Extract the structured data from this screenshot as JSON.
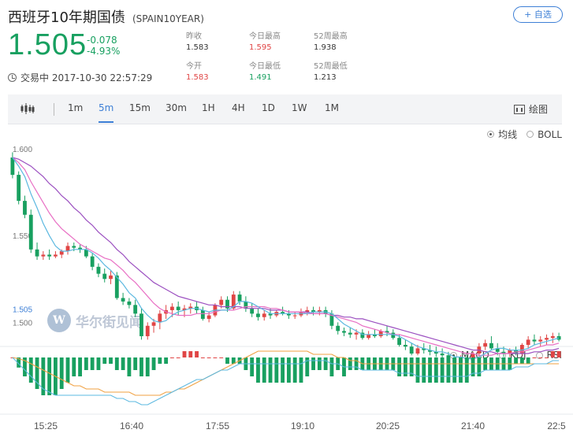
{
  "header": {
    "title": "西班牙10年期国债",
    "code": "(SPAIN10YEAR)",
    "add_button": "+ 自选"
  },
  "quote": {
    "price": "1.505",
    "change": "-0.078",
    "change_pct": "-4.93%",
    "status": "交易中 2017-10-30 22:57:29"
  },
  "stats": {
    "prev_close_label": "昨收",
    "prev_close": "1.583",
    "open_label": "今开",
    "open": "1.583",
    "high_label": "今日最高",
    "high": "1.595",
    "low_label": "今日最低",
    "low": "1.491",
    "w52_high_label": "52周最高",
    "w52_high": "1.938",
    "w52_low_label": "52周最低",
    "w52_low": "1.213"
  },
  "toolbar": {
    "periods": [
      "1m",
      "5m",
      "15m",
      "30m",
      "1H",
      "4H",
      "1D",
      "1W",
      "1M"
    ],
    "active_period": "5m",
    "draw_label": "绘图"
  },
  "main_options": {
    "ma": "均线",
    "boll": "BOLL",
    "selected": "均线"
  },
  "sub_options": {
    "macd": "MACD",
    "kdj": "KDJ",
    "rsi": "RSI",
    "selected": "MACD"
  },
  "watermark": {
    "logo": "W",
    "text": "华尔街见闻"
  },
  "colors": {
    "up": "#e04545",
    "down": "#18a060",
    "ma_short": "#5bb8e0",
    "ma_mid": "#e86fc4",
    "ma_long": "#9b4fc0",
    "macd_dea": "#f0a040",
    "accent": "#3d7fd6"
  },
  "chart_data": {
    "type": "candlestick",
    "title": "",
    "interval": "5m",
    "x_ticks": [
      "15:25",
      "16:40",
      "17:55",
      "19:10",
      "20:25",
      "21:40",
      "22:5"
    ],
    "y_ticks": [
      "1.600",
      "1.550",
      "1.500"
    ],
    "last_price_label": "1.505",
    "ylim": [
      1.487,
      1.605
    ],
    "ohlc": [
      [
        1.595,
        1.598,
        1.583,
        1.585
      ],
      [
        1.585,
        1.587,
        1.568,
        1.57
      ],
      [
        1.57,
        1.573,
        1.56,
        1.562
      ],
      [
        1.562,
        1.565,
        1.54,
        1.542
      ],
      [
        1.542,
        1.546,
        1.536,
        1.538
      ],
      [
        1.538,
        1.541,
        1.536,
        1.539
      ],
      [
        1.539,
        1.542,
        1.536,
        1.538
      ],
      [
        1.538,
        1.541,
        1.537,
        1.539
      ],
      [
        1.539,
        1.542,
        1.537,
        1.541
      ],
      [
        1.541,
        1.546,
        1.539,
        1.544
      ],
      [
        1.544,
        1.546,
        1.541,
        1.543
      ],
      [
        1.543,
        1.545,
        1.54,
        1.542
      ],
      [
        1.542,
        1.544,
        1.537,
        1.538
      ],
      [
        1.538,
        1.54,
        1.53,
        1.532
      ],
      [
        1.532,
        1.534,
        1.526,
        1.528
      ],
      [
        1.528,
        1.531,
        1.523,
        1.525
      ],
      [
        1.525,
        1.53,
        1.522,
        1.527
      ],
      [
        1.527,
        1.529,
        1.513,
        1.514
      ],
      [
        1.514,
        1.517,
        1.51,
        1.512
      ],
      [
        1.512,
        1.514,
        1.508,
        1.51
      ],
      [
        1.51,
        1.513,
        1.503,
        1.505
      ],
      [
        1.505,
        1.508,
        1.49,
        1.492
      ],
      [
        1.492,
        1.5,
        1.49,
        1.498
      ],
      [
        1.498,
        1.502,
        1.494,
        1.5
      ],
      [
        1.5,
        1.507,
        1.496,
        1.505
      ],
      [
        1.505,
        1.51,
        1.502,
        1.507
      ],
      [
        1.507,
        1.511,
        1.503,
        1.509
      ],
      [
        1.509,
        1.512,
        1.504,
        1.507
      ],
      [
        1.507,
        1.51,
        1.503,
        1.508
      ],
      [
        1.508,
        1.511,
        1.505,
        1.509
      ],
      [
        1.509,
        1.512,
        1.505,
        1.507
      ],
      [
        1.507,
        1.509,
        1.501,
        1.502
      ],
      [
        1.502,
        1.506,
        1.5,
        1.504
      ],
      [
        1.504,
        1.511,
        1.503,
        1.51
      ],
      [
        1.51,
        1.515,
        1.508,
        1.513
      ],
      [
        1.513,
        1.515,
        1.506,
        1.508
      ],
      [
        1.508,
        1.518,
        1.507,
        1.516
      ],
      [
        1.516,
        1.518,
        1.51,
        1.512
      ],
      [
        1.512,
        1.515,
        1.506,
        1.508
      ],
      [
        1.508,
        1.511,
        1.503,
        1.505
      ],
      [
        1.505,
        1.508,
        1.501,
        1.503
      ],
      [
        1.503,
        1.507,
        1.501,
        1.505
      ],
      [
        1.505,
        1.508,
        1.502,
        1.504
      ],
      [
        1.504,
        1.507,
        1.503,
        1.506
      ],
      [
        1.506,
        1.509,
        1.504,
        1.505
      ],
      [
        1.505,
        1.507,
        1.502,
        1.504
      ],
      [
        1.504,
        1.506,
        1.502,
        1.504
      ],
      [
        1.504,
        1.508,
        1.503,
        1.506
      ],
      [
        1.506,
        1.509,
        1.504,
        1.507
      ],
      [
        1.507,
        1.509,
        1.504,
        1.506
      ],
      [
        1.506,
        1.509,
        1.504,
        1.507
      ],
      [
        1.507,
        1.509,
        1.503,
        1.505
      ],
      [
        1.505,
        1.507,
        1.496,
        1.498
      ],
      [
        1.498,
        1.5,
        1.493,
        1.495
      ],
      [
        1.495,
        1.497,
        1.492,
        1.494
      ],
      [
        1.494,
        1.497,
        1.491,
        1.493
      ],
      [
        1.493,
        1.496,
        1.49,
        1.494
      ],
      [
        1.494,
        1.496,
        1.49,
        1.491
      ],
      [
        1.491,
        1.495,
        1.49,
        1.493
      ],
      [
        1.493,
        1.496,
        1.491,
        1.492
      ],
      [
        1.492,
        1.496,
        1.491,
        1.495
      ],
      [
        1.495,
        1.498,
        1.492,
        1.494
      ],
      [
        1.494,
        1.496,
        1.49,
        1.491
      ],
      [
        1.491,
        1.493,
        1.486,
        1.487
      ],
      [
        1.487,
        1.49,
        1.484,
        1.486
      ],
      [
        1.486,
        1.488,
        1.481,
        1.482
      ],
      [
        1.482,
        1.487,
        1.481,
        1.485
      ],
      [
        1.485,
        1.488,
        1.482,
        1.484
      ],
      [
        1.484,
        1.487,
        1.481,
        1.483
      ],
      [
        1.483,
        1.486,
        1.48,
        1.482
      ],
      [
        1.482,
        1.485,
        1.479,
        1.481
      ],
      [
        1.481,
        1.483,
        1.478,
        1.479
      ],
      [
        1.479,
        1.481,
        1.476,
        1.477
      ],
      [
        1.477,
        1.481,
        1.476,
        1.479
      ],
      [
        1.479,
        1.481,
        1.477,
        1.478
      ],
      [
        1.478,
        1.483,
        1.477,
        1.482
      ],
      [
        1.482,
        1.488,
        1.48,
        1.486
      ],
      [
        1.486,
        1.49,
        1.484,
        1.488
      ],
      [
        1.488,
        1.492,
        1.484,
        1.485
      ],
      [
        1.485,
        1.488,
        1.481,
        1.483
      ],
      [
        1.483,
        1.486,
        1.48,
        1.482
      ],
      [
        1.482,
        1.485,
        1.48,
        1.484
      ],
      [
        1.484,
        1.486,
        1.481,
        1.482
      ],
      [
        1.482,
        1.488,
        1.481,
        1.487
      ],
      [
        1.487,
        1.492,
        1.485,
        1.49
      ],
      [
        1.49,
        1.493,
        1.487,
        1.489
      ],
      [
        1.489,
        1.492,
        1.486,
        1.49
      ],
      [
        1.49,
        1.493,
        1.487,
        1.491
      ],
      [
        1.491,
        1.494,
        1.488,
        1.492
      ],
      [
        1.492,
        1.494,
        1.489,
        1.49
      ]
    ],
    "ma5": [
      1.595,
      1.59,
      1.584,
      1.574,
      1.566,
      1.557,
      1.55,
      1.544,
      1.541,
      1.541,
      1.542,
      1.542,
      1.542,
      1.54,
      1.537,
      1.533,
      1.53,
      1.526,
      1.522,
      1.517,
      1.514,
      1.508,
      1.504,
      1.501,
      1.5,
      1.501,
      1.504,
      1.506,
      1.507,
      1.508,
      1.508,
      1.507,
      1.506,
      1.507,
      1.507,
      1.507,
      1.509,
      1.512,
      1.512,
      1.511,
      1.509,
      1.507,
      1.505,
      1.505,
      1.505,
      1.505,
      1.505,
      1.505,
      1.505,
      1.506,
      1.506,
      1.506,
      1.505,
      1.502,
      1.499,
      1.497,
      1.495,
      1.493,
      1.493,
      1.493,
      1.493,
      1.493,
      1.493,
      1.492,
      1.49,
      1.488,
      1.486,
      1.485,
      1.484,
      1.483,
      1.483,
      1.482,
      1.48,
      1.48,
      1.479,
      1.479,
      1.48,
      1.482,
      1.484,
      1.485,
      1.485,
      1.484,
      1.484,
      1.484,
      1.485,
      1.487,
      1.488,
      1.489,
      1.49,
      1.491
    ],
    "ma10": [
      1.595,
      1.592,
      1.588,
      1.581,
      1.575,
      1.569,
      1.563,
      1.558,
      1.554,
      1.551,
      1.548,
      1.545,
      1.543,
      1.541,
      1.539,
      1.537,
      1.536,
      1.533,
      1.53,
      1.526,
      1.523,
      1.519,
      1.515,
      1.511,
      1.508,
      1.506,
      1.505,
      1.504,
      1.504,
      1.504,
      1.505,
      1.505,
      1.505,
      1.506,
      1.507,
      1.507,
      1.507,
      1.508,
      1.509,
      1.509,
      1.509,
      1.509,
      1.508,
      1.508,
      1.507,
      1.506,
      1.506,
      1.506,
      1.505,
      1.505,
      1.505,
      1.505,
      1.504,
      1.503,
      1.502,
      1.501,
      1.5,
      1.498,
      1.497,
      1.496,
      1.495,
      1.494,
      1.493,
      1.493,
      1.492,
      1.491,
      1.49,
      1.489,
      1.488,
      1.487,
      1.486,
      1.485,
      1.484,
      1.483,
      1.482,
      1.482,
      1.481,
      1.481,
      1.481,
      1.482,
      1.482,
      1.482,
      1.483,
      1.483,
      1.484,
      1.485,
      1.486,
      1.487,
      1.487,
      1.488
    ],
    "ma20": [
      1.595,
      1.594,
      1.592,
      1.59,
      1.587,
      1.584,
      1.58,
      1.577,
      1.573,
      1.57,
      1.566,
      1.563,
      1.559,
      1.556,
      1.552,
      1.549,
      1.546,
      1.542,
      1.539,
      1.535,
      1.532,
      1.529,
      1.526,
      1.523,
      1.521,
      1.519,
      1.517,
      1.515,
      1.514,
      1.513,
      1.512,
      1.511,
      1.51,
      1.51,
      1.509,
      1.509,
      1.509,
      1.509,
      1.508,
      1.508,
      1.508,
      1.508,
      1.507,
      1.507,
      1.507,
      1.506,
      1.506,
      1.506,
      1.506,
      1.505,
      1.505,
      1.505,
      1.504,
      1.504,
      1.503,
      1.503,
      1.502,
      1.502,
      1.501,
      1.5,
      1.499,
      1.498,
      1.497,
      1.496,
      1.495,
      1.494,
      1.493,
      1.492,
      1.491,
      1.49,
      1.489,
      1.488,
      1.487,
      1.486,
      1.485,
      1.484,
      1.484,
      1.483,
      1.483,
      1.482,
      1.482,
      1.482,
      1.482,
      1.482,
      1.482,
      1.483,
      1.483,
      1.484,
      1.484,
      1.485
    ],
    "macd": {
      "dif": [
        0,
        -0.002,
        -0.004,
        -0.006,
        -0.008,
        -0.01,
        -0.011,
        -0.012,
        -0.012,
        -0.012,
        -0.012,
        -0.012,
        -0.012,
        -0.012,
        -0.012,
        -0.012,
        -0.012,
        -0.013,
        -0.013,
        -0.014,
        -0.014,
        -0.015,
        -0.015,
        -0.014,
        -0.013,
        -0.012,
        -0.011,
        -0.01,
        -0.009,
        -0.008,
        -0.007,
        -0.007,
        -0.006,
        -0.005,
        -0.004,
        -0.004,
        -0.003,
        -0.002,
        -0.002,
        -0.002,
        -0.002,
        -0.002,
        -0.002,
        -0.002,
        -0.002,
        -0.002,
        -0.002,
        -0.002,
        -0.001,
        -0.001,
        -0.001,
        -0.001,
        -0.002,
        -0.002,
        -0.003,
        -0.003,
        -0.003,
        -0.004,
        -0.004,
        -0.004,
        -0.004,
        -0.004,
        -0.004,
        -0.005,
        -0.005,
        -0.005,
        -0.006,
        -0.006,
        -0.006,
        -0.006,
        -0.006,
        -0.006,
        -0.006,
        -0.006,
        -0.006,
        -0.005,
        -0.005,
        -0.004,
        -0.004,
        -0.004,
        -0.004,
        -0.004,
        -0.003,
        -0.003,
        -0.003,
        -0.002,
        -0.002,
        -0.002,
        -0.001,
        -0.001
      ],
      "dea": [
        0,
        -0.0004,
        -0.001,
        -0.002,
        -0.003,
        -0.004,
        -0.005,
        -0.006,
        -0.007,
        -0.008,
        -0.009,
        -0.009,
        -0.01,
        -0.01,
        -0.01,
        -0.011,
        -0.011,
        -0.011,
        -0.011,
        -0.011,
        -0.012,
        -0.012,
        -0.012,
        -0.012,
        -0.012,
        -0.011,
        -0.011,
        -0.01,
        -0.01,
        -0.009,
        -0.008,
        -0.007,
        -0.006,
        -0.005,
        -0.004,
        -0.003,
        -0.002,
        -0.001,
        0.0,
        0.001,
        0.002,
        0.002,
        0.002,
        0.002,
        0.002,
        0.002,
        0.002,
        0.002,
        0.002,
        0.001,
        0.001,
        0.001,
        0.001,
        0.0,
        0.0,
        -0.001,
        -0.001,
        -0.002,
        -0.002,
        -0.002,
        -0.002,
        -0.002,
        -0.002,
        -0.002,
        -0.002,
        -0.002,
        -0.002,
        -0.002,
        -0.002,
        -0.002,
        -0.002,
        -0.002,
        -0.002,
        -0.002,
        -0.002,
        -0.002,
        -0.002,
        -0.002,
        -0.002,
        -0.002,
        -0.002,
        -0.002,
        -0.002,
        -0.002,
        -0.002,
        -0.002,
        -0.002,
        -0.002,
        -0.002,
        -0.002
      ]
    }
  }
}
